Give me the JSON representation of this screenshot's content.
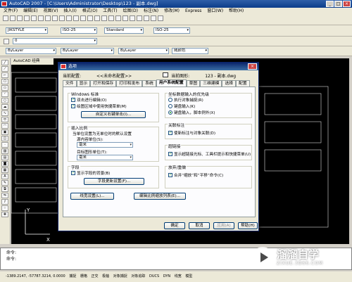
{
  "window": {
    "title": "AutoCAD 2007 - [C:\\Users\\Administrator\\Desktop\\123 - 副本.dwg]"
  },
  "menu": [
    "文件(F)",
    "编辑(E)",
    "视图(V)",
    "插入(I)",
    "格式(O)",
    "工具(T)",
    "绘图(D)",
    "标注(N)",
    "修改(M)",
    "Express",
    "窗口(W)",
    "帮助(H)"
  ],
  "toolbar": {
    "text_style": "JIKSTYLE",
    "dim_style": "ISO-25",
    "table_style": "Standard",
    "dim_style2": "ISO-25",
    "layer": "0",
    "layer_by": "ByLayer",
    "linetype": "ByLayer",
    "lineweight": "ByLayer",
    "color": "随颜色"
  },
  "drawing_tab": "AutoCAD 经典",
  "dialog": {
    "title": "选项",
    "current_profile_label": "当前配置:",
    "current_profile_value": "<<未命名配置>>",
    "current_drawing_label": "当前图形:",
    "current_drawing_value": "123 - 副本.dwg",
    "tabs": [
      "文件",
      "显示",
      "打开和保存",
      "打印和发布",
      "系统",
      "用户系统配置",
      "草图",
      "三维建模",
      "选择",
      "配置"
    ],
    "windows_std": {
      "title": "Windows 标准",
      "cb1": "双击进行编辑(O)",
      "cb2": "绘图区域中使用快捷菜单(M)",
      "btn": "自定义右键单击(I)..."
    },
    "insert_scale": {
      "title": "插入比例",
      "desc": "当单位设置为无单位时的默认设置",
      "src_label": "源内容单位(S):",
      "src_value": "毫米",
      "tgt_label": "目标图形单位(T):",
      "tgt_value": "毫米"
    },
    "fields": {
      "title": "字段",
      "cb": "显示字段的背景(B)",
      "btn": "字段更新设置(F)..."
    },
    "coord_priority": {
      "title": "坐标数据输入的优先级",
      "r1": "执行对象捕捉(R)",
      "r2": "键盘输入(K)",
      "r3": "键盘输入，脚本例外(X)"
    },
    "assoc_dim": {
      "title": "关联标注",
      "cb": "使新标注与对象关联(D)"
    },
    "hyperlink": {
      "title": "超链接",
      "cb": "显示超链接光标、工具栏提示和快捷菜单(U)"
    },
    "undo": {
      "title": "放弃/重做",
      "cb": "合并“缩放”和“平移”命令(C)"
    },
    "lineweight_btn": "线宽设置(L)...",
    "scale_list_btn": "编辑比例缩放列表(E)...",
    "ok": "确定",
    "cancel": "取消",
    "apply": "应用(A)",
    "help": "帮助(H)"
  },
  "command": {
    "line1": "命令:",
    "line2": "命令:"
  },
  "statusbar": {
    "coords": "-1389.2147, -57787.3214, 0.0000",
    "items": [
      "捕捉",
      "栅格",
      "正交",
      "极轴",
      "对象捕捉",
      "对象追踪",
      "DUCS",
      "DYN",
      "线宽",
      "模型"
    ]
  },
  "watermark": {
    "name": "溜溜自学",
    "url": "ZIXUE.3D66.COM"
  }
}
